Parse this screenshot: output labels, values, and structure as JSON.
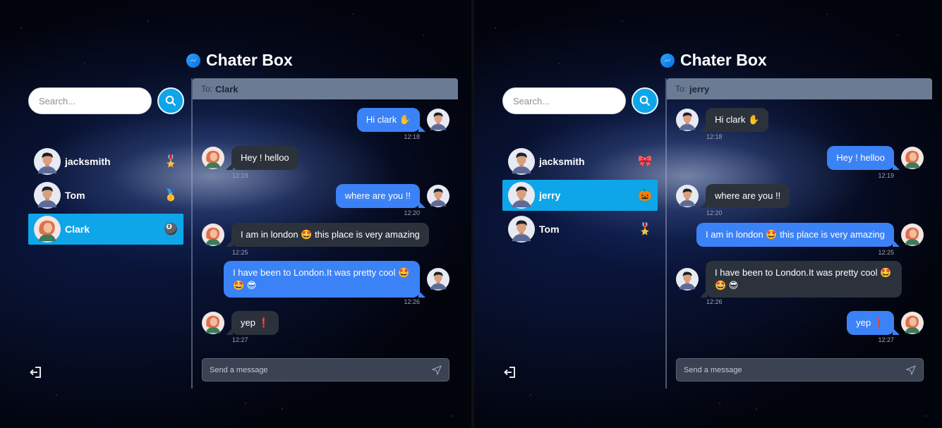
{
  "app_title": "Chater Box",
  "colors": {
    "accent": "#0ea5e9",
    "me_bubble": "#3b82f6",
    "them_bubble": "#2c323c",
    "header": "#6b7b94"
  },
  "left": {
    "search_placeholder": "Search...",
    "to_prefix": "To:",
    "chat_with": "Clark",
    "users": [
      {
        "name": "jacksmith",
        "badge": "🎖️",
        "active": false
      },
      {
        "name": "Tom",
        "badge": "🥇",
        "active": false
      },
      {
        "name": "Clark",
        "badge": "🎱",
        "active": true
      }
    ],
    "messages": [
      {
        "from": "me",
        "text": "Hi clark ✋",
        "time": "12:18"
      },
      {
        "from": "them",
        "text": "Hey ! helloo",
        "time": "12:19"
      },
      {
        "from": "me",
        "text": "where are you !!",
        "time": "12:20"
      },
      {
        "from": "them",
        "text": "I am in london 🤩 this place is very amazing",
        "time": "12:25"
      },
      {
        "from": "me",
        "text": "I have been to London.It was pretty cool 🤩",
        "text2": "🤩 😎",
        "time": "12:26"
      },
      {
        "from": "them",
        "text": "yep ❗",
        "time": "12:27"
      }
    ],
    "composer_placeholder": "Send a message"
  },
  "right": {
    "search_placeholder": "Search...",
    "to_prefix": "To:",
    "chat_with": "jerry",
    "users": [
      {
        "name": "jacksmith",
        "badge": "🎀",
        "active": false
      },
      {
        "name": "jerry",
        "badge": "🎃",
        "active": true
      },
      {
        "name": "Tom",
        "badge": "🎖️",
        "active": false
      }
    ],
    "messages": [
      {
        "from": "them",
        "text": "Hi clark ✋",
        "time": "12:18"
      },
      {
        "from": "me",
        "text": "Hey ! helloo",
        "time": "12:19"
      },
      {
        "from": "them",
        "text": "where are you !!",
        "time": "12:20"
      },
      {
        "from": "me",
        "text": "I am in london 🤩 this place is very amazing",
        "time": "12:25"
      },
      {
        "from": "them",
        "text": "I have been to London.It was pretty cool 🤩",
        "text2": "🤩 😎",
        "time": "12:26"
      },
      {
        "from": "me",
        "text": "yep ❗",
        "time": "12:27"
      }
    ],
    "composer_placeholder": "Send a message"
  }
}
